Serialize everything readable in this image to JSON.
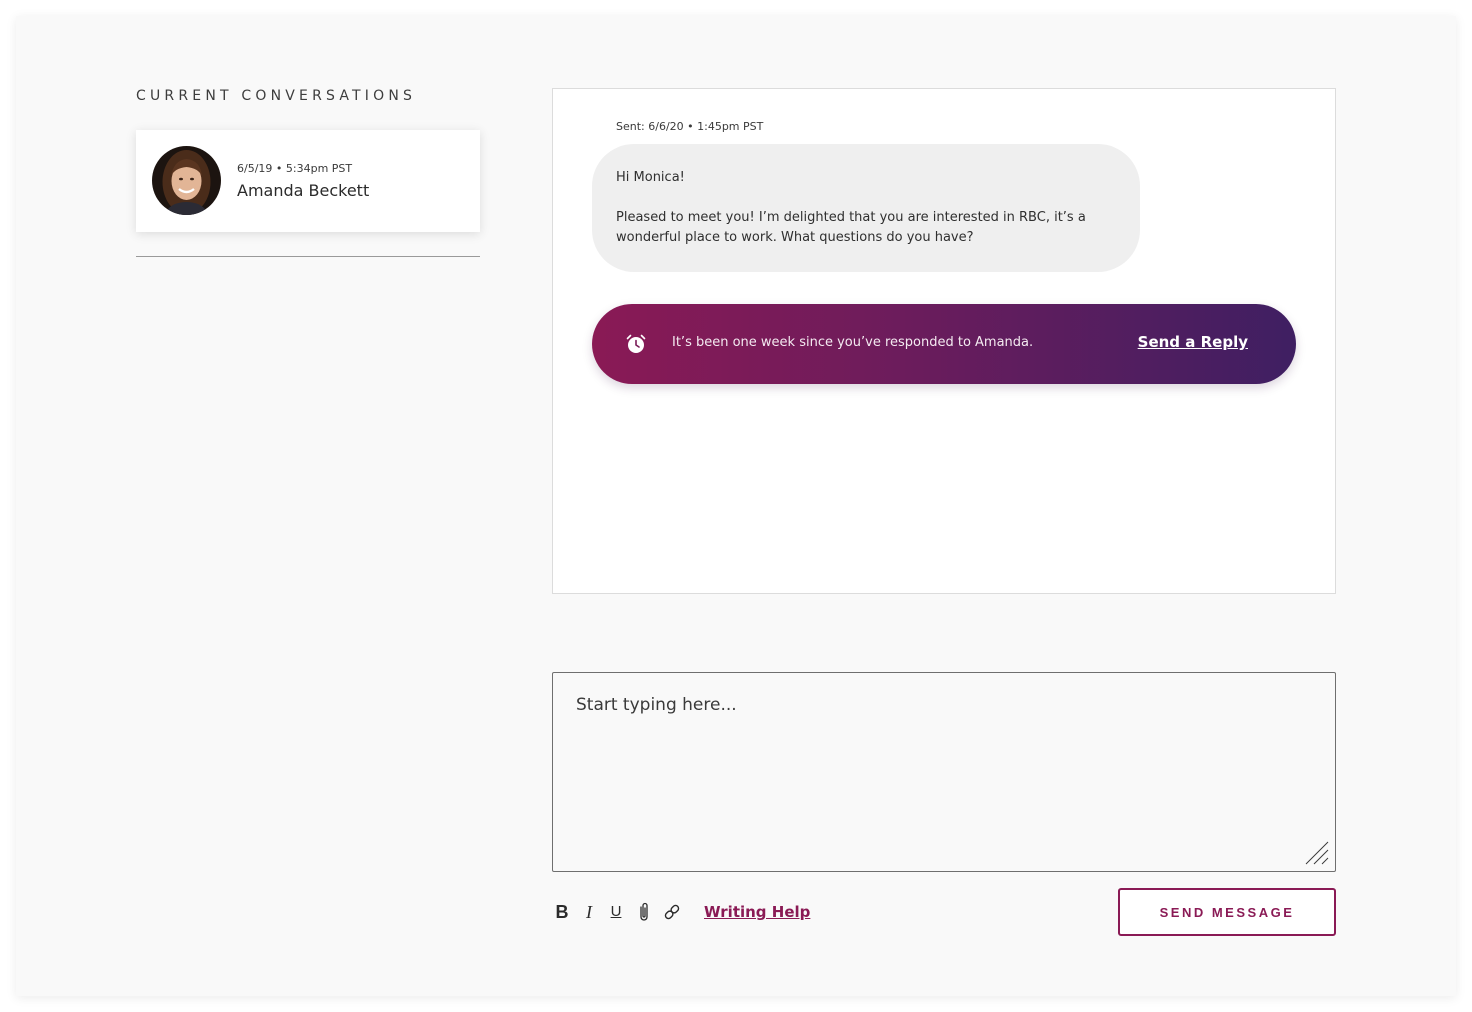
{
  "sidebar": {
    "title": "CURRENT CONVERSATIONS",
    "conversations": [
      {
        "date": "6/5/19 • 5:34pm PST",
        "name": "Amanda Beckett"
      }
    ]
  },
  "thread": {
    "sent_meta": "Sent: 6/6/20 • 1:45pm PST",
    "message_paragraphs": [
      "Hi Monica!",
      "Pleased to meet you! I’m delighted that you are interested in RBC, it’s a wonderful place to work. What questions do you have?"
    ],
    "reminder": {
      "icon": "alarm-clock-icon",
      "text": "It’s been one week since you’ve responded to Amanda.",
      "action_label": "Send a Reply"
    }
  },
  "composer": {
    "placeholder": "Start typing here...",
    "value": ""
  },
  "toolbar": {
    "bold_label": "B",
    "italic_label": "I",
    "underline_label": "U",
    "attach_icon": "paperclip-icon",
    "link_icon": "link-icon",
    "writing_help_label": "Writing Help",
    "send_label": "SEND MESSAGE"
  },
  "colors": {
    "accent": "#8a1a55",
    "gradient_start": "#8a1a55",
    "gradient_end": "#3f1f62",
    "page_background": "#f9f9f9",
    "bubble_background": "#efefef"
  }
}
